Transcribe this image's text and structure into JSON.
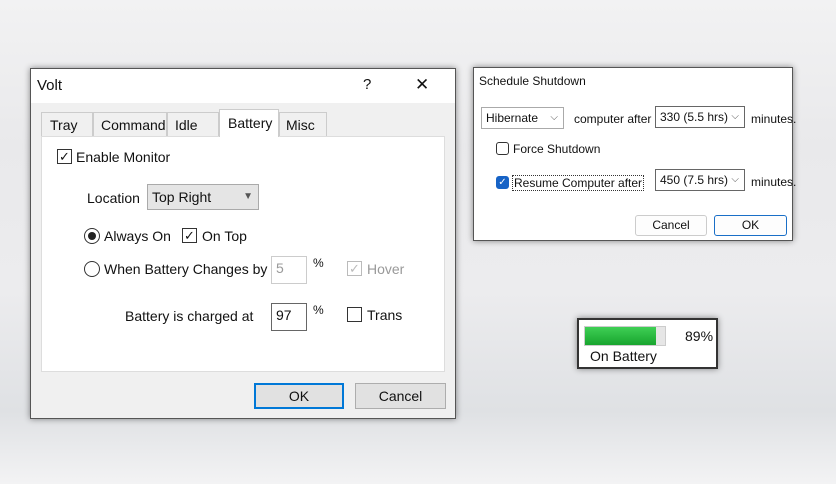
{
  "volt": {
    "title": "Volt",
    "help": "?",
    "close": "✕",
    "tabs": [
      "Tray",
      "Command",
      "Idle",
      "Battery",
      "Misc"
    ],
    "enable_monitor": "Enable Monitor",
    "enable_checked": true,
    "location_label": "Location",
    "location_value": "Top Right",
    "always_on": "Always On",
    "on_top": "On Top",
    "when_changes": "When Battery Changes by",
    "changes_value": "5",
    "percent": "%",
    "hover": "Hover",
    "charged_label": "Battery is charged at",
    "charged_value": "97",
    "trans": "Trans",
    "ok": "OK",
    "cancel": "Cancel"
  },
  "shutdown": {
    "title": "Schedule Shutdown",
    "action": "Hibernate",
    "computer_after": "computer after",
    "after_value": "330 (5.5 hrs)",
    "minutes": "minutes.",
    "force": "Force Shutdown",
    "resume": "Resume Computer after",
    "resume_value": "450 (7.5 hrs)",
    "cancel": "Cancel",
    "ok": "OK"
  },
  "battery_widget": {
    "percent_text": "89%",
    "level": 89,
    "status": "On Battery",
    "fill_color": "#22b33a"
  }
}
